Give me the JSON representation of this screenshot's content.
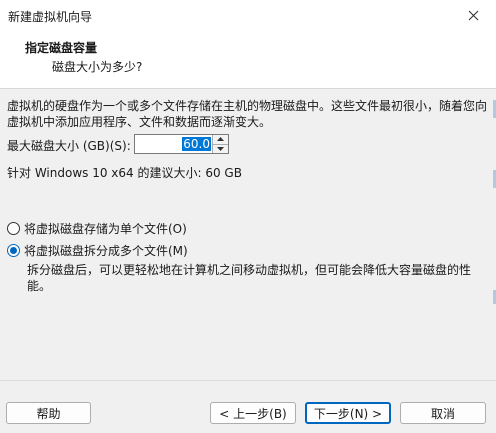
{
  "window": {
    "title": "新建虚拟机向导",
    "close_icon": "close-icon"
  },
  "header": {
    "title": "指定磁盘容量",
    "subtitle": "磁盘大小为多少?"
  },
  "main": {
    "description": "虚拟机的硬盘作为一个或多个文件存储在主机的物理磁盘中。这些文件最初很小，随着您向虚拟机中添加应用程序、文件和数据而逐渐变大。",
    "max_size_label": "最大磁盘大小 (GB)(S):",
    "max_size_value": "60.0",
    "recommendation": "针对 Windows 10 x64 的建议大小: 60 GB",
    "options": [
      {
        "label": "将虚拟磁盘存储为单个文件(O)",
        "checked": false
      },
      {
        "label": "将虚拟磁盘拆分成多个文件(M)",
        "checked": true
      }
    ],
    "split_note": "拆分磁盘后，可以更轻松地在计算机之间移动虚拟机，但可能会降低大容量磁盘的性能。"
  },
  "footer": {
    "help_label": "帮助",
    "back_label": "< 上一步(B)",
    "next_label": "下一步(N) >",
    "cancel_label": "取消"
  },
  "colors": {
    "accent": "#0067c0",
    "selection": "#0078d7",
    "panel_bg": "#f0f0f0"
  }
}
